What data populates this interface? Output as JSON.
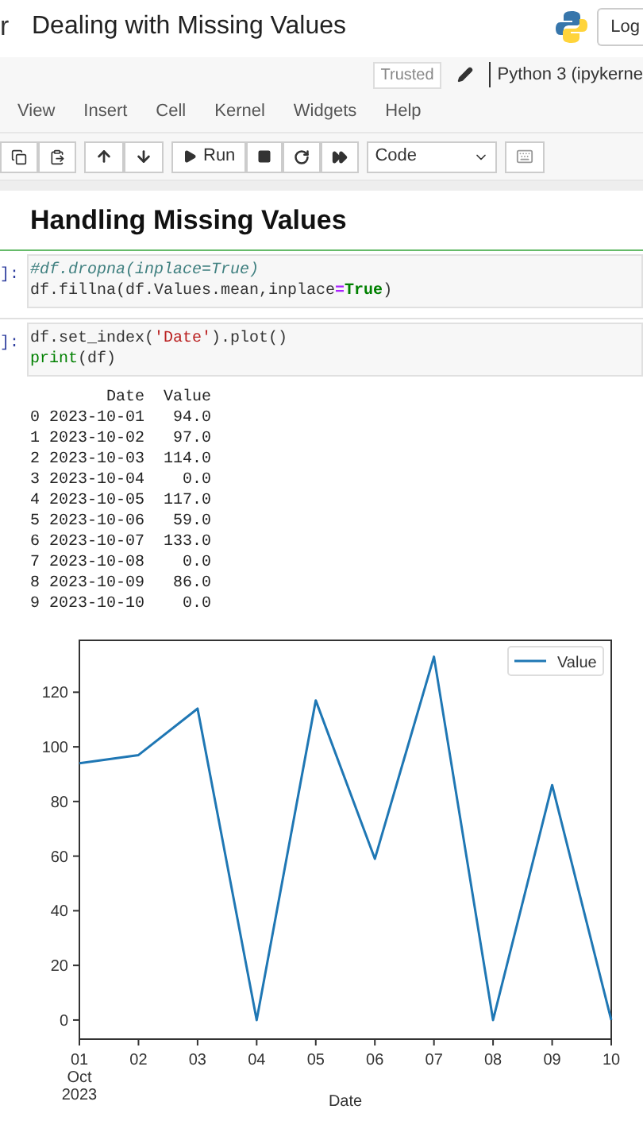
{
  "header": {
    "logo_fragment": "r",
    "title": "Dealing with Missing Values",
    "login_button": "Log"
  },
  "kernel_bar": {
    "trusted": "Trusted",
    "kernel": "Python 3 (ipykerne"
  },
  "menu": [
    "View",
    "Insert",
    "Cell",
    "Kernel",
    "Widgets",
    "Help"
  ],
  "toolbar": {
    "run": "Run",
    "cell_type": "Code"
  },
  "heading": "Handling Missing Values",
  "cells": [
    {
      "prompt": "]:",
      "selected": true,
      "lines": [
        [
          {
            "kind": "comment",
            "text": "#df.dropna(inplace=True)"
          }
        ],
        [
          {
            "kind": "plain",
            "text": "df.fillna(df.Values.mean,inplace"
          },
          {
            "kind": "operator",
            "text": "="
          },
          {
            "kind": "keyword",
            "text": "True"
          },
          {
            "kind": "plain",
            "text": ")"
          }
        ]
      ]
    },
    {
      "prompt": "]:",
      "selected": false,
      "lines": [
        [
          {
            "kind": "plain",
            "text": "df.set_index("
          },
          {
            "kind": "string",
            "text": "'Date'"
          },
          {
            "kind": "plain",
            "text": ").plot()"
          }
        ],
        [
          {
            "kind": "builtin",
            "text": "print"
          },
          {
            "kind": "plain",
            "text": "(df)"
          }
        ]
      ]
    }
  ],
  "output": {
    "lines": [
      "        Date  Value",
      "0 2023-10-01   94.0",
      "1 2023-10-02   97.0",
      "2 2023-10-03  114.0",
      "3 2023-10-04    0.0",
      "4 2023-10-05  117.0",
      "5 2023-10-06   59.0",
      "6 2023-10-07  133.0",
      "7 2023-10-08    0.0",
      "8 2023-10-09   86.0",
      "9 2023-10-10    0.0"
    ],
    "chart_data": {
      "type": "line",
      "xlabel": "Date",
      "categories": [
        "01 Oct 2023",
        "02",
        "03",
        "04",
        "05",
        "06",
        "07",
        "08",
        "09",
        "10"
      ],
      "series": [
        {
          "name": "Value",
          "color": "#1f77b4",
          "values": [
            94,
            97,
            114,
            0,
            117,
            59,
            133,
            0,
            86,
            0
          ]
        }
      ],
      "ylim": [
        -7,
        139
      ],
      "yticks": [
        0,
        20,
        40,
        60,
        80,
        100,
        120
      ]
    }
  }
}
